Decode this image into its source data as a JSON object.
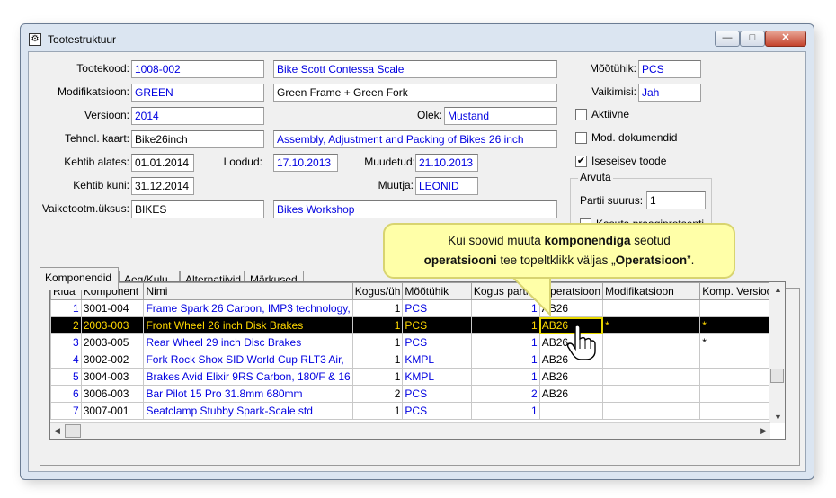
{
  "window": {
    "title": "Tootestruktuur",
    "min": "—",
    "max": "□",
    "close": "✕"
  },
  "form": {
    "tootekood_label": "Tootekood:",
    "tootekood": "1008-002",
    "tootekood_name": "Bike Scott Contessa Scale",
    "modif_label": "Modifikatsioon:",
    "modif": "GREEN",
    "modif_name": "Green Frame + Green Fork",
    "version_label": "Versioon:",
    "version": "2014",
    "olek_label": "Olek:",
    "olek": "Mustand",
    "tehn_label": "Tehnol. kaart:",
    "tehn": "Bike26inch",
    "tehn_name": "Assembly, Adjustment and Packing of Bikes 26 inch",
    "kehtib_alates_label": "Kehtib alates:",
    "kehtib_alates": "01.01.2014",
    "loodud_label": "Loodud:",
    "loodud": "17.10.2013",
    "muudetud_label": "Muudetud:",
    "muudetud": "21.10.2013",
    "kehtib_kuni_label": "Kehtib kuni:",
    "kehtib_kuni": "31.12.2014",
    "muutja_label": "Muutja:",
    "muutja": "LEONID",
    "vaike_label": "Vaiketootm.üksus:",
    "vaike": "BIKES",
    "vaike_name": "Bikes Workshop",
    "mootuhik_label": "Mõõtühik:",
    "mootuhik": "PCS",
    "vaikimisi_label": "Vaikimisi:",
    "vaikimisi": "Jah",
    "aktiivne_label": "Aktiivne",
    "mod_dok_label": "Mod. dokumendid",
    "iseseisev_label": "Iseseisev toode",
    "arvuta_label": "Arvuta",
    "partii_label": "Partii suurus:",
    "partii": "1",
    "kasuta_label": "Kasuta praagiprotsenti"
  },
  "tabs": [
    "Komponendid",
    "Aeg/Kulu",
    "Alternatiivid",
    "Märkused"
  ],
  "grid": {
    "headers": [
      "Rida",
      "Komponent",
      "Nimi",
      "Kogus/üh",
      "Mõõtühik",
      "Kogus partiis",
      "Operatsioon",
      "Modifikatsioon",
      "Komp. Versioon"
    ],
    "rows": [
      [
        "1",
        "3001-004",
        "Frame Spark 26 Carbon, IMP3 technology,",
        "1",
        "PCS",
        "1",
        "AB26",
        "",
        ""
      ],
      [
        "2",
        "2003-003",
        "Front Wheel 26 inch Disk Brakes",
        "1",
        "PCS",
        "1",
        "AB26",
        "*",
        "*"
      ],
      [
        "3",
        "2003-005",
        "Rear Wheel 29 inch Disc Brakes",
        "1",
        "PCS",
        "1",
        "AB26",
        "",
        "*"
      ],
      [
        "4",
        "3002-002",
        "Fork Rock Shox SID World Cup RLT3 Air,",
        "1",
        "KMPL",
        "1",
        "AB26",
        "",
        ""
      ],
      [
        "5",
        "3004-003",
        "Brakes Avid Elixir 9RS Carbon, 180/F & 16",
        "1",
        "KMPL",
        "1",
        "AB26",
        "",
        ""
      ],
      [
        "6",
        "3006-003",
        "Bar Pilot 15 Pro 31.8mm 680mm",
        "2",
        "PCS",
        "2",
        "AB26",
        "",
        ""
      ],
      [
        "7",
        "3007-001",
        "Seatclamp Stubby Spark-Scale std",
        "1",
        "PCS",
        "1",
        "",
        "",
        ""
      ]
    ]
  },
  "callout": {
    "part1": "Kui soovid muuta ",
    "bold1": "komponendiga",
    "part2": " seotud",
    "bold2": "operatsiooni",
    "part3": " tee topeltklikk väljas „",
    "bold3": "Operatsioon",
    "part4": "”."
  }
}
